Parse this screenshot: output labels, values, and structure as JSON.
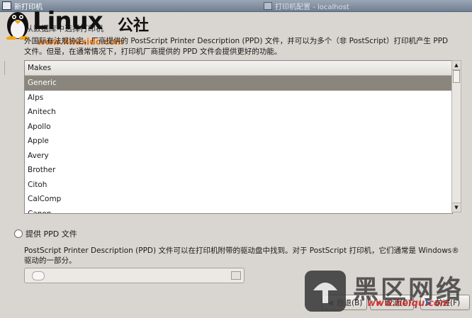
{
  "window": {
    "title": "新打印机",
    "background_window_title": "打印机配置 - localhost"
  },
  "watermarks": {
    "top_logo": "Linux",
    "top_logo_cn": "公社",
    "top_url": "www.linuxidc.com",
    "bottom_cn": "黑区网络",
    "bottom_url": "www.heiqu.com"
  },
  "radio_hidden_label": "从数据库中选择打印机",
  "description": "外国际有法规协定，厂商提供的 PostScript Printer Description (PPD) 文件，并可以为多个（非 PostScript）打印机产生 PPD 文件。但是，在通常情况下，打印机厂商提供的 PPD 文件会提供更好的功能。",
  "makes_list": {
    "header": "Makes",
    "items": [
      "Generic",
      "Alps",
      "Anitech",
      "Apollo",
      "Apple",
      "Avery",
      "Brother",
      "Citoh",
      "CalComp",
      "Canon"
    ],
    "selected_index": 0
  },
  "ppd": {
    "radio_label": "提供 PPD 文件",
    "description": "PostScript Printer Description (PPD) 文件可以在打印机附带的驱动盘中找到。对于 PostScript 打印机，它们通常是 Windows® 驱动的一部分。"
  },
  "buttons": {
    "back": "后退(B)",
    "cancel": "取消(C)",
    "forward": "前进(F)"
  },
  "colors": {
    "selection": "#8b867d",
    "dialog_bg": "#d9d5d0"
  }
}
